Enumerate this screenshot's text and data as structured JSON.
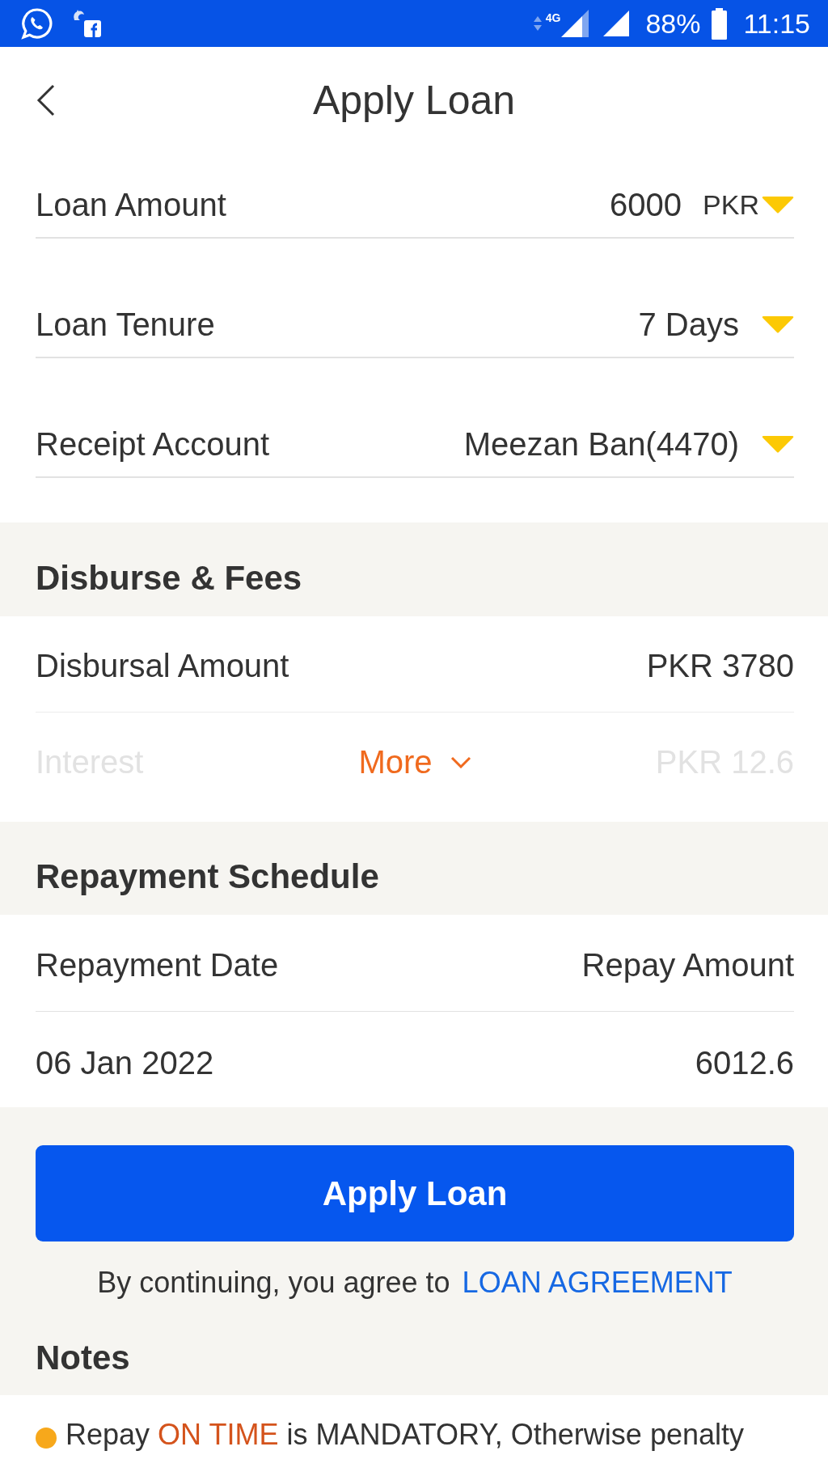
{
  "status_bar": {
    "network_label": "4G",
    "battery": "88%",
    "time": "11:15"
  },
  "header": {
    "title": "Apply Loan"
  },
  "form": [
    {
      "label": "Loan Amount",
      "value": "6000",
      "unit": "PKR"
    },
    {
      "label": "Loan Tenure",
      "value": "7 Days"
    },
    {
      "label": "Receipt Account",
      "value": "Meezan Ban(4470)"
    }
  ],
  "fees": {
    "title": "Disburse & Fees",
    "expanded": false,
    "more_label": "More",
    "rows": [
      {
        "label": "Disbursal Amount",
        "value": "PKR 3780"
      },
      {
        "label": "Interest",
        "value": "PKR 12.6"
      }
    ]
  },
  "schedule": {
    "title": "Repayment Schedule",
    "columns": [
      "Repayment Date",
      "Repay Amount"
    ],
    "rows": [
      [
        "06 Jan 2022",
        "6012.6"
      ]
    ]
  },
  "apply_button": "Apply Loan",
  "agreement": {
    "text": "By continuing, you agree to",
    "link": "LOAN AGREEMENT"
  },
  "notes": {
    "title": "Notes",
    "items": [
      {
        "parts": [
          {
            "text": "Repay ",
            "highlight": false
          },
          {
            "text": "ON TIME",
            "highlight": true
          },
          {
            "text": " is MANDATORY, Otherwise penalty",
            "highlight": false
          }
        ]
      }
    ]
  }
}
